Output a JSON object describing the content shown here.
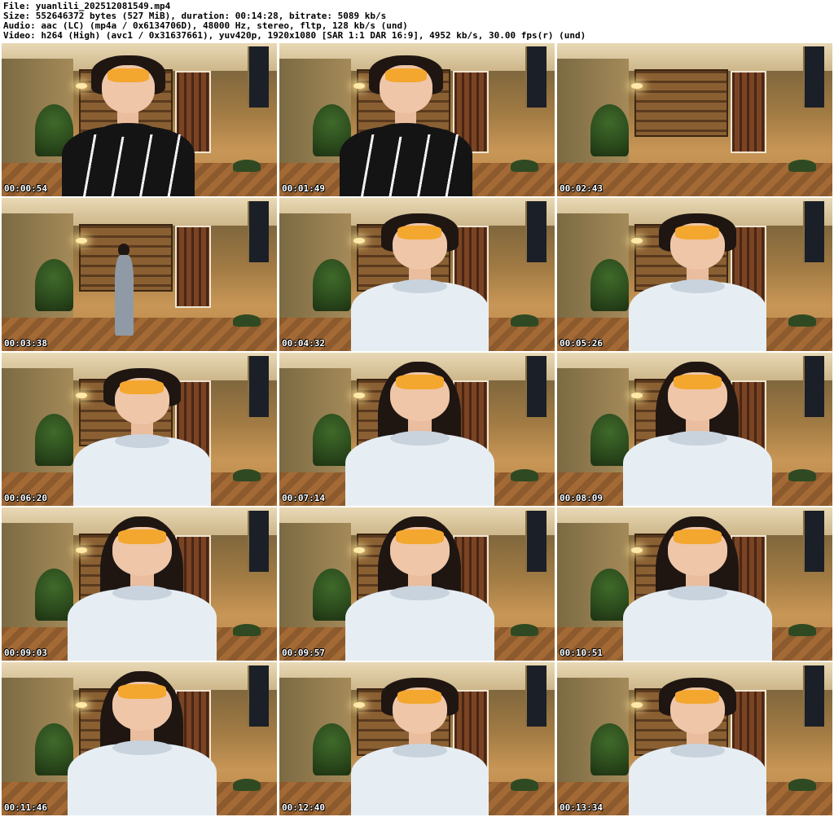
{
  "info": {
    "file": "File: yuanlili_202512081549.mp4",
    "size": "Size: 552646372 bytes (527 MiB), duration: 00:14:28, bitrate: 5089 kb/s",
    "audio": "Audio: aac (LC) (mp4a / 0x6134706D), 48000 Hz, stereo, fltp, 128 kb/s (und)",
    "video": "Video: h264 (High) (avc1 / 0x31637661), yuv420p, 1920x1080 [SAR 1:1 DAR 16:9], 4952 kb/s, 30.00 fps(r) (und)"
  },
  "thumbnails": [
    {
      "timestamp": "00:00:54",
      "scene": "seated-jacket"
    },
    {
      "timestamp": "00:01:49",
      "scene": "seated-jacket"
    },
    {
      "timestamp": "00:02:43",
      "scene": "empty-room"
    },
    {
      "timestamp": "00:03:38",
      "scene": "standing-away"
    },
    {
      "timestamp": "00:04:32",
      "scene": "seated-blouse"
    },
    {
      "timestamp": "00:05:26",
      "scene": "seated-blouse"
    },
    {
      "timestamp": "00:06:20",
      "scene": "seated-blouse"
    },
    {
      "timestamp": "00:07:14",
      "scene": "seated-blouse-longhair"
    },
    {
      "timestamp": "00:08:09",
      "scene": "seated-blouse-longhair"
    },
    {
      "timestamp": "00:09:03",
      "scene": "seated-blouse-longhair"
    },
    {
      "timestamp": "00:09:57",
      "scene": "seated-blouse-longhair"
    },
    {
      "timestamp": "00:10:51",
      "scene": "seated-blouse-longhair"
    },
    {
      "timestamp": "00:11:46",
      "scene": "seated-blouse-longhair"
    },
    {
      "timestamp": "00:12:40",
      "scene": "seated-blouse"
    },
    {
      "timestamp": "00:13:34",
      "scene": "seated-blouse"
    }
  ],
  "colors": {
    "background": "#ffffff",
    "header_text": "#000000",
    "timestamp_text": "#ffffff",
    "mask_overlay": "#f4a72e",
    "jacket": "#141414",
    "blouse": "#e6eef4"
  }
}
